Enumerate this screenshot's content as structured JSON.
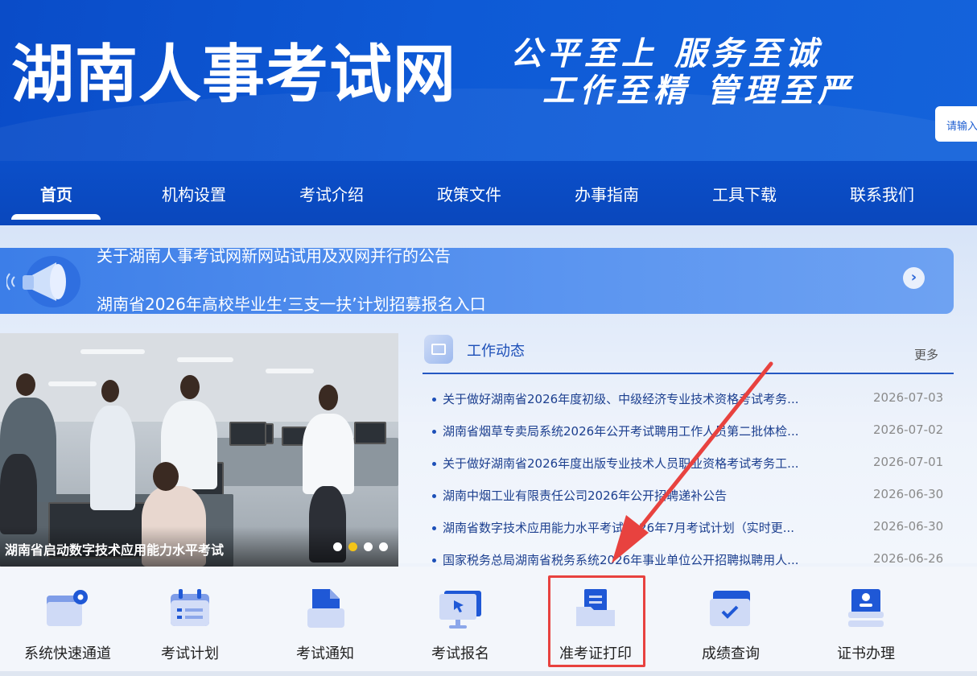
{
  "header": {
    "site_title": "湖南人事考试网",
    "slogan_line1": "公平至上 服务至诚",
    "slogan_line2": "工作至精 管理至严",
    "search_placeholder": "请输入"
  },
  "nav": {
    "items": [
      {
        "label": "首页",
        "active": true
      },
      {
        "label": "机构设置"
      },
      {
        "label": "考试介绍"
      },
      {
        "label": "政策文件"
      },
      {
        "label": "办事指南"
      },
      {
        "label": "工具下载"
      },
      {
        "label": "联系我们"
      }
    ]
  },
  "notice": {
    "items": [
      "关于湖南人事考试网新网站试用及双网并行的公告",
      "湖南省2026年高校毕业生‘三支一扶’计划招募报名入口"
    ],
    "arrow_icon": "chevron-right-icon"
  },
  "carousel": {
    "caption": "湖南省启动数字技术应用能力水平考试",
    "active_index": 1,
    "slide_count": 4
  },
  "news": {
    "title": "工作动态",
    "more": "更多",
    "items": [
      {
        "title": "关于做好湖南省2026年度初级、中级经济专业技术资格考试考务...",
        "date": "2026-07-03"
      },
      {
        "title": "湖南省烟草专卖局系统2026年公开考试聘用工作人员第二批体检...",
        "date": "2026-07-02"
      },
      {
        "title": "关于做好湖南省2026年度出版专业技术人员职业资格考试考务工...",
        "date": "2026-07-01"
      },
      {
        "title": "湖南中烟工业有限责任公司2026年公开招聘递补公告",
        "date": "2026-06-30"
      },
      {
        "title": "湖南省数字技术应用能力水平考试2026年7月考试计划（实时更...",
        "date": "2026-06-30"
      },
      {
        "title": "国家税务总局湖南省税务系统2026年事业单位公开招聘拟聘用人...",
        "date": "2026-06-26"
      }
    ]
  },
  "quick_links": [
    {
      "label": "系统快速通道",
      "icon": "gear-window-icon"
    },
    {
      "label": "考试计划",
      "icon": "calendar-icon"
    },
    {
      "label": "考试通知",
      "icon": "document-icon"
    },
    {
      "label": "考试报名",
      "icon": "monitor-cursor-icon"
    },
    {
      "label": "准考证打印",
      "icon": "folder-document-icon"
    },
    {
      "label": "成绩查询",
      "icon": "score-check-icon"
    },
    {
      "label": "证书办理",
      "icon": "certificate-icon"
    }
  ],
  "colors": {
    "brand_blue": "#0a4cc8",
    "highlight_red": "#e8423f",
    "carousel_active_dot": "#f5c518"
  }
}
